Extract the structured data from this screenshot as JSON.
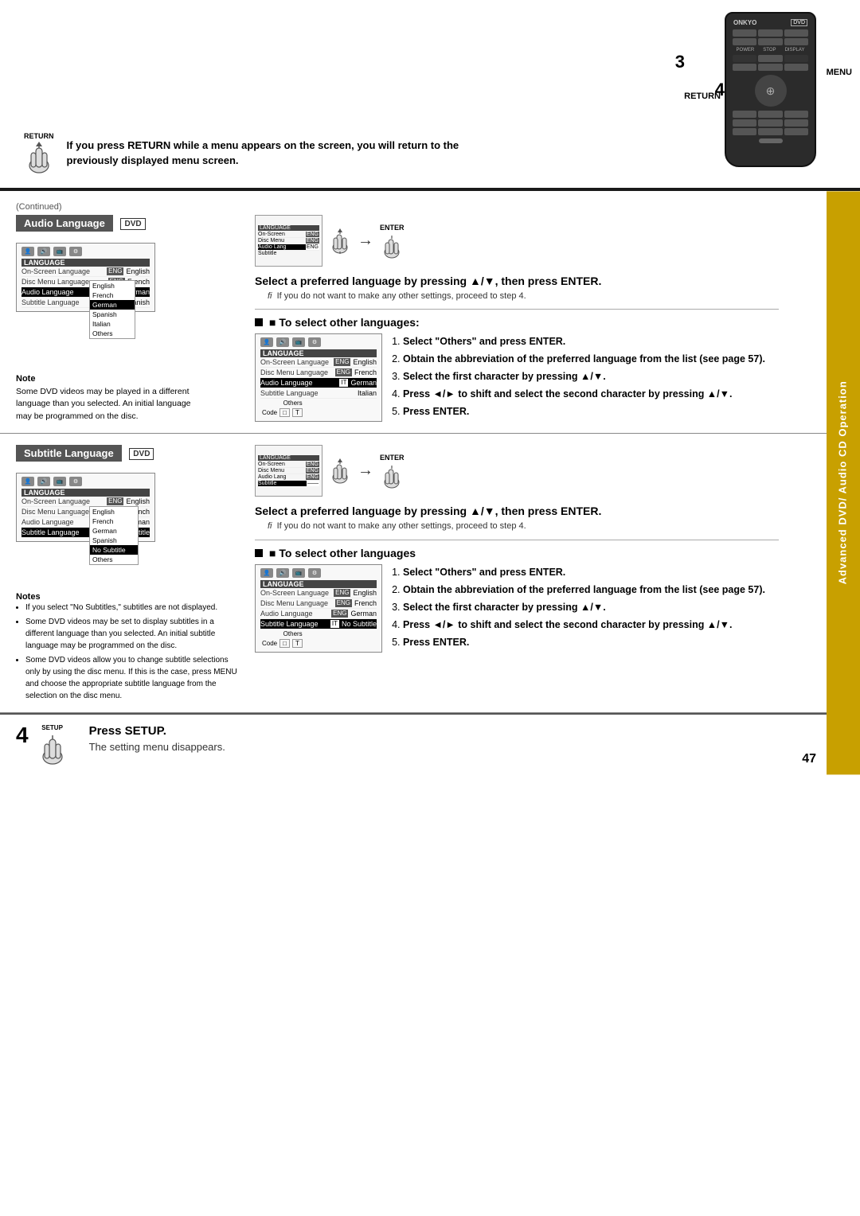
{
  "page": {
    "number": "47",
    "side_tab": "Advanced DVD/\nAudio CD Operation"
  },
  "top_section": {
    "number3": "3",
    "number4": "4",
    "menu_label": "MENU",
    "return_label": "RETURN",
    "return_icon_label": "RETURN",
    "instruction": "If you press RETURN while a menu appears on the screen, you will return to the previously displayed menu screen."
  },
  "continued_label": "(Continued)",
  "audio_language": {
    "title": "Audio Language",
    "dvd_badge": "DVD",
    "select_header": "Select a preferred language by pressing ▲/▼, then press ENTER.",
    "fi_text": "If you do not want to make any other settings, proceed to step 4.",
    "to_select_header": "■ To select other languages:",
    "steps": [
      "Select \"Others\" and press ENTER.",
      "Obtain the abbreviation of the preferred language from the list (see page 57).",
      "Select the first character by pressing ▲/▼.",
      "Press ◄/► to shift and select the second character by pressing ▲/▼.",
      "Press ENTER."
    ],
    "note_title": "Note",
    "note_text": "Some DVD videos may be played in a different language than you selected. An initial language may be programmed on the disc.",
    "screen1": {
      "label": "LANGUAGE",
      "rows": [
        {
          "key": "On-Screen Language",
          "badge": "ENG",
          "val": "English"
        },
        {
          "key": "Disc Menu Language",
          "badge": "ENG",
          "val": "French"
        },
        {
          "key": "Audio Language",
          "badge": "ENG",
          "val": "German"
        },
        {
          "key": "Subtitle Language",
          "badge": "",
          "val": "Spanish"
        }
      ],
      "list": [
        "English",
        "French",
        "German",
        "Spanish",
        "Italian",
        "Others"
      ]
    },
    "screen2": {
      "label": "LANGUAGE",
      "rows": [
        {
          "key": "On-Screen Language",
          "badge": "ENG",
          "val": "English"
        },
        {
          "key": "Disc Menu Language",
          "badge": "ENG",
          "val": "French"
        },
        {
          "key": "Audio Language",
          "badge": "IT",
          "val": "German"
        },
        {
          "key": "Subtitle Language",
          "badge": "",
          "val": "Italian"
        }
      ],
      "extra": [
        "Others"
      ],
      "code_row": "Code"
    }
  },
  "subtitle_language": {
    "title": "Subtitle Language",
    "dvd_badge": "DVD",
    "select_header": "Select a preferred language by pressing ▲/▼, then press ENTER.",
    "fi_text": "If you do not want to make any other settings, proceed to step 4.",
    "to_select_header": "■ To select other languages",
    "steps": [
      "Select \"Others\" and press ENTER.",
      "Obtain the abbreviation of the preferred language from the list (see page 57).",
      "Select the first character by pressing ▲/▼.",
      "Press ◄/► to shift and select the second character by pressing ▲/▼.",
      "Press ENTER."
    ],
    "notes_title": "Notes",
    "notes": [
      "If you select \"No Subtitles,\" subtitles are not displayed.",
      "Some DVD videos may be set to display subtitles in a different language than you selected. An initial subtitle language may be programmed on the disc.",
      "Some DVD videos allow you to change subtitle selections only by using the disc menu. If this is the case, press MENU and choose the appropriate subtitle language from the selection on the disc menu."
    ],
    "screen1": {
      "label": "LANGUAGE",
      "rows": [
        {
          "key": "On-Screen Language",
          "badge": "ENG",
          "val": "English"
        },
        {
          "key": "Disc Menu Language",
          "badge": "ENG",
          "val": "French"
        },
        {
          "key": "Audio Language",
          "badge": "ENG",
          "val": "German"
        },
        {
          "key": "Subtitle Language",
          "badge": "——",
          "val": "No Subtitle"
        }
      ],
      "list": [
        "English",
        "French",
        "German",
        "Spanish",
        "No Subtitle",
        "Others"
      ]
    },
    "screen2": {
      "label": "LANGUAGE",
      "rows": [
        {
          "key": "On-Screen Language",
          "badge": "ENG",
          "val": "English"
        },
        {
          "key": "Disc Menu Language",
          "badge": "ENG",
          "val": "French"
        },
        {
          "key": "Audio Language",
          "badge": "ENG",
          "val": "German"
        },
        {
          "key": "Subtitle Language",
          "badge": "IT",
          "val": "No Subtitle"
        }
      ],
      "extra": [
        "Others"
      ],
      "code_row": "Code"
    }
  },
  "step4": {
    "number": "4",
    "setup_label": "SETUP",
    "press_setup": "Press SETUP.",
    "description": "The setting menu disappears."
  }
}
